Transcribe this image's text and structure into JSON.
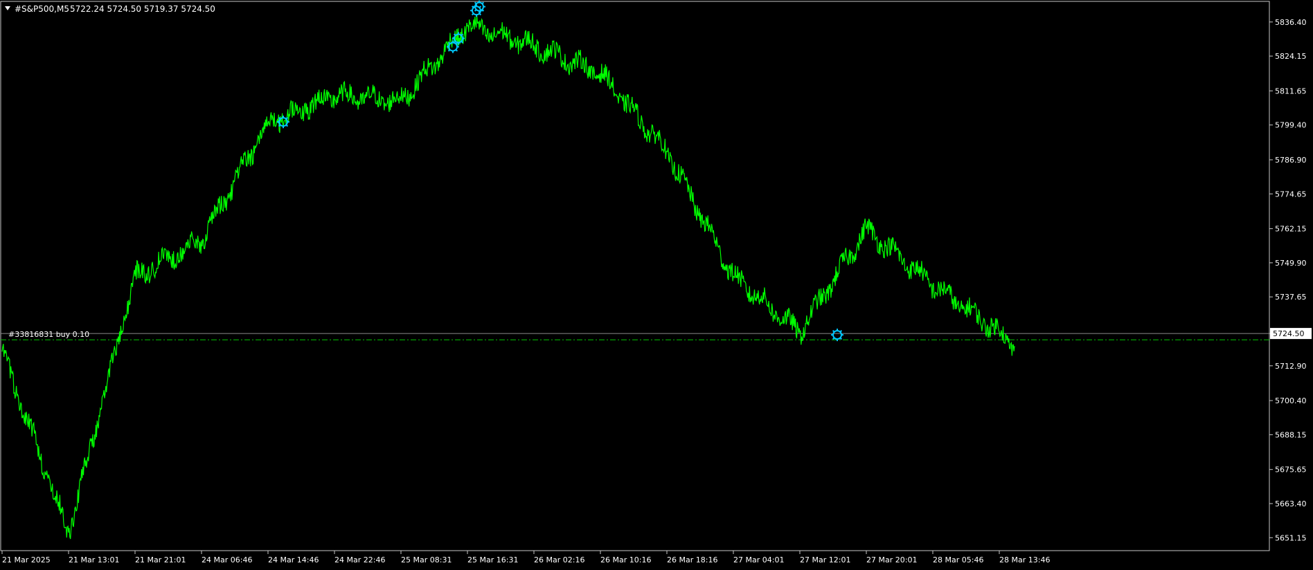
{
  "header": {
    "menu_icon": "triangle-down-icon",
    "symbol": "#S&P500,M5",
    "ohlc": "5722.24 5724.50 5719.37 5724.50"
  },
  "price_axis": {
    "ticks": [
      "5836.40",
      "5824.15",
      "5811.65",
      "5799.40",
      "5786.90",
      "5774.65",
      "5762.15",
      "5749.90",
      "5737.65",
      "5724.50",
      "5712.90",
      "5700.40",
      "5688.15",
      "5675.65",
      "5663.40",
      "5651.15"
    ],
    "current_price_label": "5724.50"
  },
  "time_axis": {
    "ticks": [
      "21 Mar 2025",
      "21 Mar 13:01",
      "21 Mar 21:01",
      "24 Mar 06:46",
      "24 Mar 14:46",
      "24 Mar 22:46",
      "25 Mar 08:31",
      "25 Mar 16:31",
      "26 Mar 02:16",
      "26 Mar 10:16",
      "26 Mar 18:16",
      "27 Mar 04:01",
      "27 Mar 12:01",
      "27 Mar 20:01",
      "28 Mar 05:46",
      "28 Mar 13:46"
    ]
  },
  "order_line": {
    "label": "#33816831 buy 0.10"
  },
  "colors": {
    "background": "#000000",
    "price_line": "#00ff00",
    "axis": "#c8c8c8",
    "text": "#ffffff",
    "marker": "#00c8ff",
    "order_line": "#00c800"
  },
  "chart_data": {
    "type": "line",
    "title": "#S&P500,M5",
    "xlabel": "",
    "ylabel": "",
    "ylim": [
      5646.5,
      5843.8
    ],
    "last_price": 5724.5,
    "order_price": 5722.24,
    "x": [
      "21 Mar 2025",
      "21 Mar 13:01",
      "21 Mar 21:01",
      "24 Mar 06:46",
      "24 Mar 14:46",
      "24 Mar 22:46",
      "25 Mar 08:31",
      "25 Mar 16:31",
      "26 Mar 02:16",
      "26 Mar 10:16",
      "26 Mar 18:16",
      "27 Mar 04:01",
      "27 Mar 12:01",
      "27 Mar 20:01",
      "28 Mar 05:46",
      "28 Mar 13:46",
      "28 Mar 15:30"
    ],
    "series": [
      {
        "values": [
          5718,
          5653,
          5745,
          5758,
          5800,
          5810,
          5808,
          5835,
          5828,
          5818,
          5790,
          5745,
          5725,
          5762,
          5742,
          5725,
          5720
        ]
      }
    ],
    "trade_markers": [
      5800.5,
      5827.5,
      5830.5,
      5840.5,
      5724.0
    ]
  }
}
